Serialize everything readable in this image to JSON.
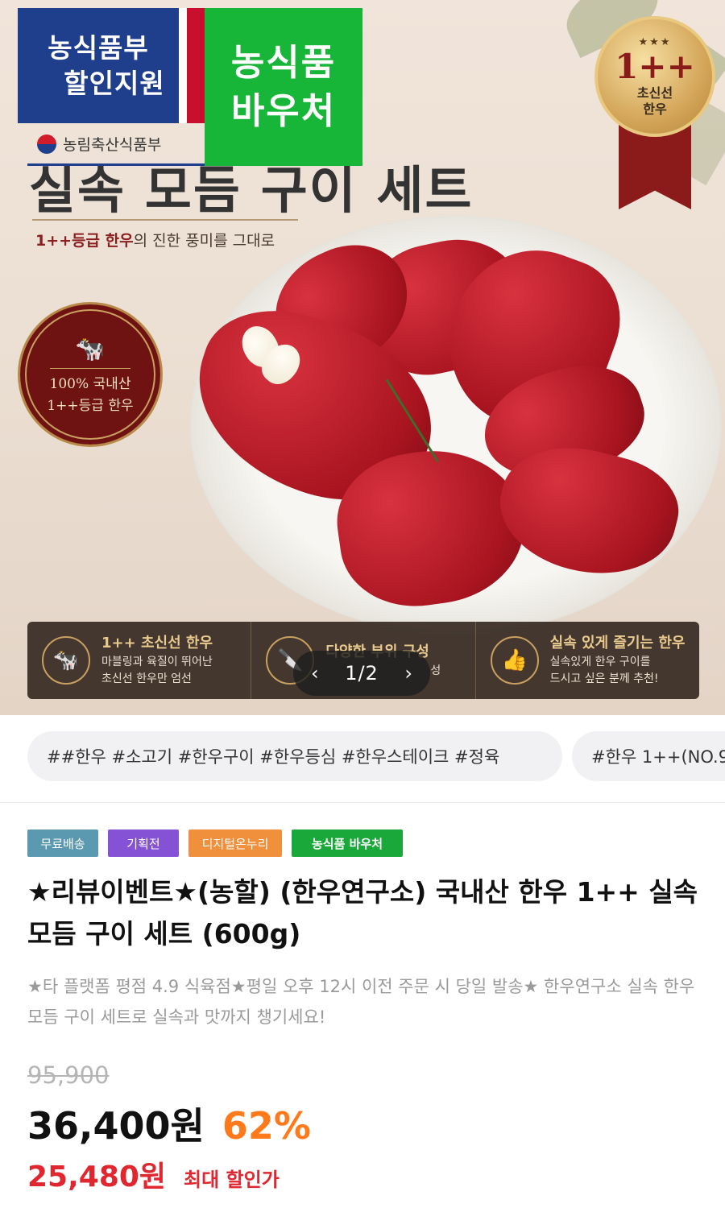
{
  "hero": {
    "gov_badge": {
      "line1": "농식품부",
      "line2": "할인지원"
    },
    "voucher_badge": {
      "line1": "농식품",
      "line2": "바우처"
    },
    "ministry": "농림축산식품부",
    "title": "실속 모듬 구이 세트",
    "subtitle_prefix": "1++등급 한우",
    "subtitle_suffix": "의 진한 풍미를 그대로",
    "medal": {
      "stars": "★★★",
      "grade": "1++",
      "line1": "초신선",
      "line2": "한우"
    },
    "seal": {
      "line1": "100% 국내산",
      "line2": "1++등급 한우"
    },
    "features": [
      {
        "icon": "cow-icon",
        "title": "1++ 초신선 한우",
        "desc1": "마블링과 육질이 뛰어난",
        "desc2": "초신선 한우만 엄선"
      },
      {
        "icon": "knife-icon",
        "title": "다양한 부위 구성",
        "desc1": "",
        "desc2": "성"
      },
      {
        "icon": "thumbs-up-icon",
        "title": "실속 있게 즐기는 한우",
        "desc1": "실속있게 한우 구이를",
        "desc2": "드시고 싶은 분께 추천!"
      }
    ],
    "pager": {
      "prev": "‹",
      "count": "1/2",
      "next": "›"
    }
  },
  "tags": {
    "chip1": "##한우 #소고기 #한우구이 #한우등심 #한우스테이크 #정육",
    "chip2": "#한우 1++(NO.9"
  },
  "badges": [
    {
      "label": "무료배송",
      "color": "#5b99b0"
    },
    {
      "label": "기획전",
      "color": "#8552d6"
    },
    {
      "label": "디지털온누리",
      "color": "#f0903c"
    },
    {
      "label": "농식품 바우처",
      "color": "#1aa83a"
    }
  ],
  "product": {
    "title": "★리뷰이벤트★(농할) (한우연구소) 국내산 한우 1++ 실속 모듬 구이 세트 (600g)",
    "description": "★타 플랫폼 평점 4.9 식육점★평일 오후 12시 이전 주문 시 당일 발송★ 한우연구소 실속 한우 모듬 구이 세트로 실속과 맛까지 챙기세요!"
  },
  "price": {
    "original": "95,900",
    "current": "36,400원",
    "discount": "62%",
    "max_price": "25,480원",
    "max_label": "최대 할인가"
  }
}
